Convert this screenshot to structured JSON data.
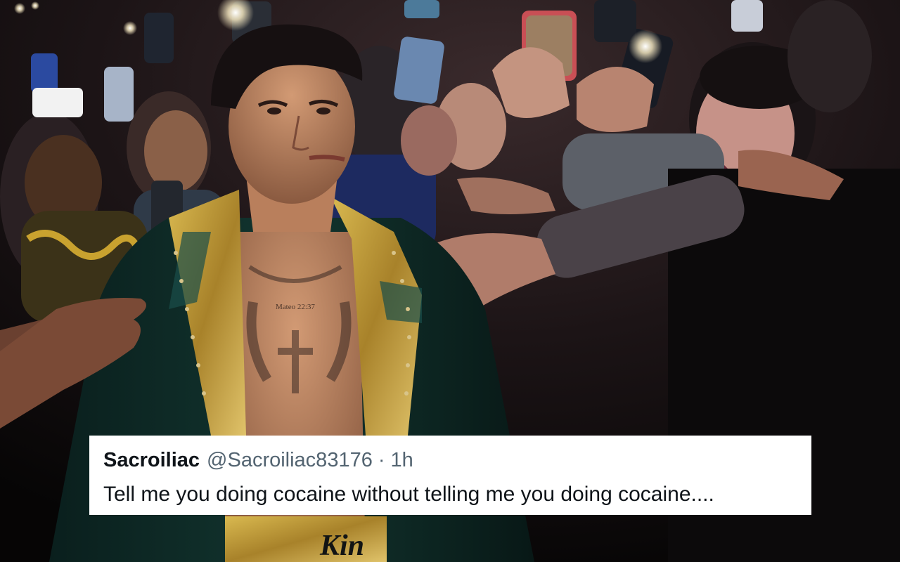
{
  "photo": {
    "palette": {
      "background": "#0d0b0c",
      "robe_velvet": "#0f2f2c",
      "robe_gold": "#b8962e",
      "skin": "#b07a5a",
      "crowd_shadow": "#2a2023",
      "phone_flash": "#fff6d8"
    },
    "trunks_text": "Kin"
  },
  "tweet": {
    "display_name": "Sacroiliac",
    "handle": "@Sacroiliac83176",
    "separator": "·",
    "timestamp": "1h",
    "text": "Tell me you doing cocaine without telling me you doing cocaine....",
    "colors": {
      "card_bg": "#ffffff",
      "name": "#0f1419",
      "meta": "#536471",
      "text": "#0f1419"
    }
  }
}
